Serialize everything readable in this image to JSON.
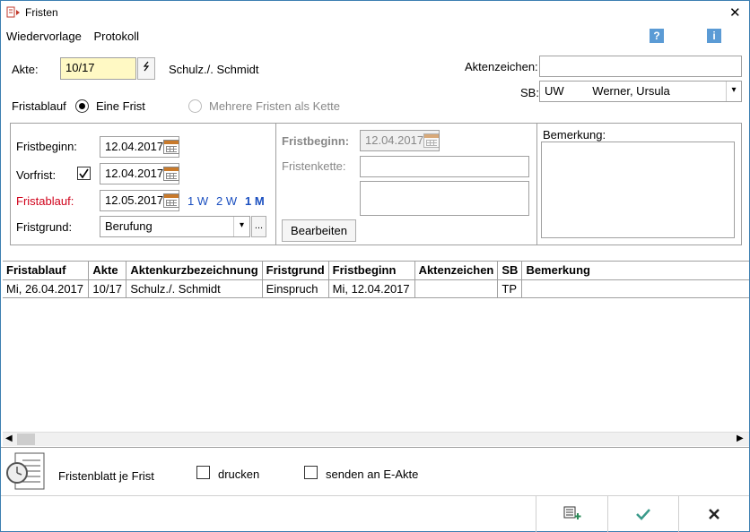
{
  "window": {
    "title": "Fristen",
    "close_glyph": "✕"
  },
  "menu": {
    "items": [
      "Wiedervorlage",
      "Protokoll"
    ],
    "help_glyph": "?",
    "info_glyph": "i"
  },
  "header": {
    "akte_label": "Akte:",
    "akte_value": "10/17",
    "akte_name": "Schulz./. Schmidt",
    "aktenzeichen_label": "Aktenzeichen:",
    "aktenzeichen_value": "",
    "sb_label": "SB:",
    "sb_code": "UW",
    "sb_name": "Werner, Ursula"
  },
  "fristablauf": {
    "label": "Fristablauf",
    "option_one": "Eine Frist",
    "option_many": "Mehrere Fristen als Kette"
  },
  "left_panel": {
    "fristbeginn_label": "Fristbeginn:",
    "fristbeginn_value": "12.04.2017",
    "vorfrist_label": "Vorfrist:",
    "vorfrist_value": "12.04.2017",
    "fristablauf_label": "Fristablauf:",
    "fristablauf_value": "12.05.2017",
    "quick": [
      "1 W",
      "2 W",
      "1 M"
    ],
    "fristgrund_label": "Fristgrund:",
    "fristgrund_value": "Berufung",
    "ellipsis": "..."
  },
  "mid_panel": {
    "fristbeginn_label": "Fristbeginn:",
    "fristbeginn_value": "12.04.2017",
    "fristenkette_label": "Fristenkette:",
    "bearbeiten_label": "Bearbeiten"
  },
  "right_panel": {
    "bemerkung_label": "Bemerkung:"
  },
  "table": {
    "headers": [
      "Fristablauf",
      "Akte",
      "Aktenkurzbezeichnung",
      "Fristgrund",
      "Fristbeginn",
      "Aktenzeichen",
      "SB",
      "Bemerkung"
    ],
    "rows": [
      [
        "Mi, 26.04.2017",
        "10/17",
        "Schulz./. Schmidt",
        "Einspruch",
        "Mi, 12.04.2017",
        "",
        "TP",
        ""
      ]
    ]
  },
  "footer": {
    "fristenblatt_label": "Fristenblatt je Frist",
    "drucken_label": "drucken",
    "senden_label": "senden an E-Akte"
  },
  "colors": {
    "accent": "#1a4fc0",
    "warning": "#d0021b",
    "yellow_field": "#fff9c4"
  }
}
